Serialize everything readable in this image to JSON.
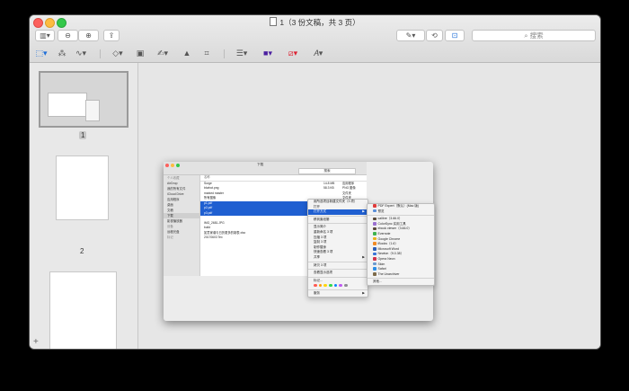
{
  "window": {
    "title": "1（3 份文稿，共 3 页）",
    "search_placeholder": "搜索"
  },
  "sidebar": {
    "pages": [
      {
        "label": "1",
        "selected": true
      },
      {
        "label": "2",
        "selected": false
      },
      {
        "label": "",
        "selected": false
      }
    ],
    "add_label": "+"
  },
  "finder": {
    "title": "下载",
    "search_placeholder": "搜索",
    "sidebar_items": [
      {
        "label": "个人收藏",
        "header": true
      },
      {
        "label": "AirDrop"
      },
      {
        "label": "我的所有文件"
      },
      {
        "label": "iCloud Drive"
      },
      {
        "label": "应用程序"
      },
      {
        "label": "桌面"
      },
      {
        "label": "文稿"
      },
      {
        "label": "下载",
        "selected": true
      },
      {
        "label": "影视播放器"
      },
      {
        "label": "设备",
        "header": true
      },
      {
        "label": "远程光盘"
      },
      {
        "label": "标记",
        "header": true
      }
    ],
    "list_header": "名称",
    "rows": [
      {
        "name": "Surge",
        "size": "14.8 MB",
        "kind": "应用程序"
      },
      {
        "name": "blurbot.png",
        "size": "58.3 KB",
        "kind": "PNG 图像"
      },
      {
        "name": "marked master",
        "size": "",
        "kind": "文件夹"
      },
      {
        "name": "所有图像",
        "size": "",
        "kind": "文件夹"
      },
      {
        "name": "p1.pdf",
        "size": "",
        "kind": "",
        "selected": true
      },
      {
        "name": "p2.pdf",
        "size": "",
        "kind": "",
        "selected": true
      },
      {
        "name": "p3.pdf",
        "size": "",
        "kind": "",
        "selected": true
      },
      {
        "name": "",
        "size": "",
        "kind": ""
      },
      {
        "name": "IMG_2681.JPG",
        "size": "",
        "kind": ""
      },
      {
        "name": "build",
        "size": "",
        "kind": ""
      },
      {
        "name": "如意家谱与日历更多的制表.xlsx",
        "size": "",
        "kind": ""
      },
      {
        "name": "20170603 Tex",
        "size": "",
        "kind": ""
      }
    ]
  },
  "context_menu": {
    "items": [
      {
        "label": "用所选项目新建文件夹（3 项）"
      },
      {
        "label": "打开"
      },
      {
        "label": "打开方式",
        "highlighted": true,
        "arrow": "▶"
      },
      {
        "separator": true
      },
      {
        "label": "移到废纸篓"
      },
      {
        "separator": true
      },
      {
        "label": "显示简介"
      },
      {
        "label": "重新命名 3 项"
      },
      {
        "label": "压缩 3 项"
      },
      {
        "label": "复制 3 项"
      },
      {
        "label": "制作替身"
      },
      {
        "label": "快速查看 3 项"
      },
      {
        "label": "共享",
        "arrow": "▶"
      },
      {
        "separator": true
      },
      {
        "label": "拷贝 3 项"
      },
      {
        "separator": true
      },
      {
        "label": "查看显示选项"
      },
      {
        "separator": true
      },
      {
        "label": "标记…"
      },
      {
        "tags": true
      },
      {
        "separator": true
      },
      {
        "label": "服务",
        "arrow": "▶"
      }
    ],
    "tag_colors": [
      "#ff5a52",
      "#ff9f0a",
      "#ffd60a",
      "#32d74b",
      "#0a84ff",
      "#bf5af2",
      "#8e8e93"
    ]
  },
  "open_with_menu": {
    "items": [
      {
        "label": "PDF Expert（默认）(Mac 版)",
        "color": "#e03b3b"
      },
      {
        "label": "预览",
        "color": "#5b8fd8"
      },
      {
        "separator": true
      },
      {
        "label": "calibre（3.66.0）",
        "color": "#5a4a3a"
      },
      {
        "label": "ColorSync 实用工具",
        "color": "#9a6fd0"
      },
      {
        "label": "ebook viewer（3.66.0）",
        "color": "#5a4a3a"
      },
      {
        "label": "Evernote",
        "color": "#3fb34f"
      },
      {
        "label": "Google Chrome",
        "color": "#e8b21e"
      },
      {
        "label": "iBooks（1.6）",
        "color": "#f08a24"
      },
      {
        "label": "Microsoft Word",
        "color": "#2b5fb7"
      },
      {
        "label": "Newton（9.0.38）",
        "color": "#3874d8"
      },
      {
        "label": "Opera Neon",
        "color": "#d2334b"
      },
      {
        "label": "Skim",
        "color": "#6a9bd0"
      },
      {
        "label": "Safari",
        "color": "#2f8fe6"
      },
      {
        "label": "The Unarchiver",
        "color": "#7d6b4a"
      },
      {
        "separator": true
      },
      {
        "label": "其他…"
      }
    ]
  }
}
